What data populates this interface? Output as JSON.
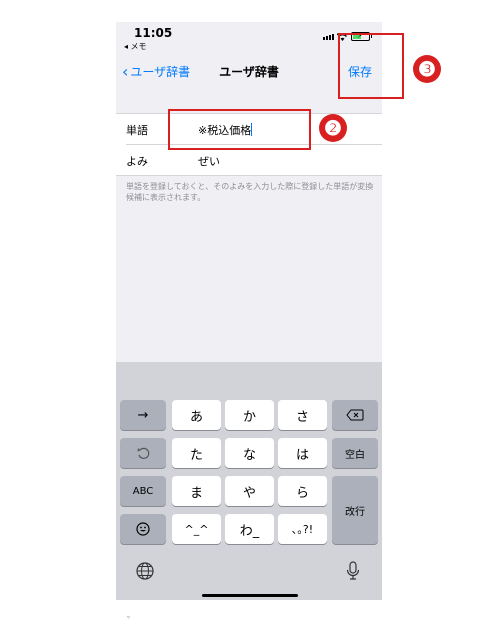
{
  "status_bar": {
    "time": "11:05",
    "back_app": "◂ メモ"
  },
  "nav": {
    "back_label": "ユーザ辞書",
    "title": "ユーザ辞書",
    "save_label": "保存"
  },
  "form": {
    "word": {
      "label": "単語",
      "value": "※税込価格"
    },
    "reading": {
      "label": "よみ",
      "value": "ぜい"
    },
    "helper_text": "単語を登録しておくと、そのよみを入力した際に登録した単語が変換候補に表示されます。"
  },
  "keyboard": {
    "row1": {
      "left": "→",
      "keys": [
        "あ",
        "か",
        "さ"
      ],
      "right_icon": "delete-icon"
    },
    "row2": {
      "left_icon": "undo-icon",
      "keys": [
        "た",
        "な",
        "は"
      ],
      "right": "空白"
    },
    "row3": {
      "left": "ABC",
      "keys": [
        "ま",
        "や",
        "ら"
      ],
      "right": "改行"
    },
    "row4": {
      "left_icon": "emoji-icon",
      "keys": [
        "^_^",
        "わ_",
        "､｡?!"
      ]
    }
  },
  "annotations": {
    "badge_2": "❷",
    "badge_3": "❸"
  },
  "colors": {
    "accent": "#007aff",
    "annotation": "#d7201f",
    "keyboard_bg": "#d1d3d9"
  }
}
